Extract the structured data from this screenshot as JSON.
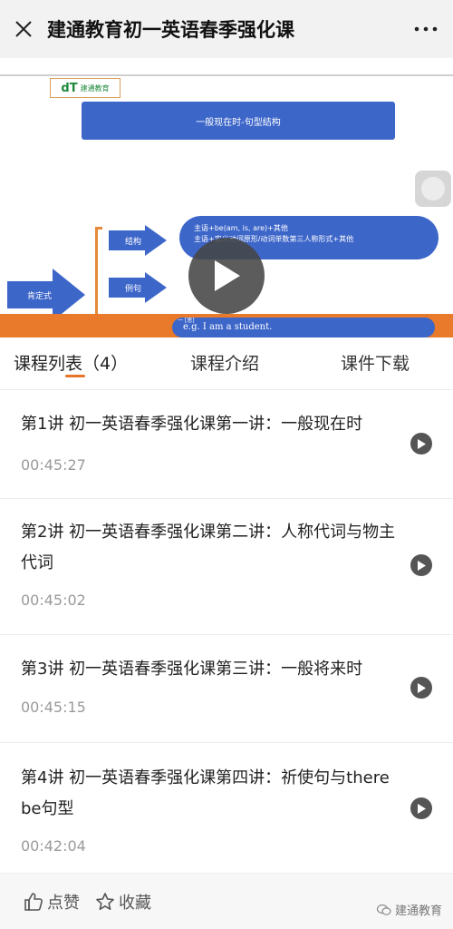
{
  "topbar": {
    "title": "建通教育初一英语春季强化课",
    "close_icon": "close-icon",
    "more_icon": "more-icon"
  },
  "video": {
    "logo_mark": "dT",
    "logo_text": "建通教育",
    "banner_text": "一般现在时-句型结构",
    "main_arrow_label": "肯定式",
    "branch_1_label": "结构",
    "branch_2_label": "例句",
    "pill_line_1": "主语+be(am, is, are)+其他",
    "pill_line_2": "主语+实义动词原形/动词单数第三人称形式+其他",
    "strip_tag": "一 [思]",
    "strip_text": "e.g. I am a student.",
    "accent_blue": "#3d66c9",
    "accent_orange": "#e97a2b"
  },
  "tabs": {
    "list": "课程列表（4）",
    "intro": "课程介绍",
    "download": "课件下载",
    "active_color": "#e8742a"
  },
  "lessons": [
    {
      "title": "第1讲 初一英语春季强化课第一讲：一般现在时",
      "duration": "00:45:27"
    },
    {
      "title": "第2讲 初一英语春季强化课第二讲：人称代词与物主代词",
      "duration": "00:45:02"
    },
    {
      "title": "第3讲 初一英语春季强化课第三讲：一般将来时",
      "duration": "00:45:15"
    },
    {
      "title": "第4讲 初一英语春季强化课第四讲：祈使句与there be句型",
      "duration": "00:42:04"
    }
  ],
  "bottombar": {
    "like_label": "点赞",
    "fav_label": "收藏",
    "watermark": "建通教育"
  }
}
